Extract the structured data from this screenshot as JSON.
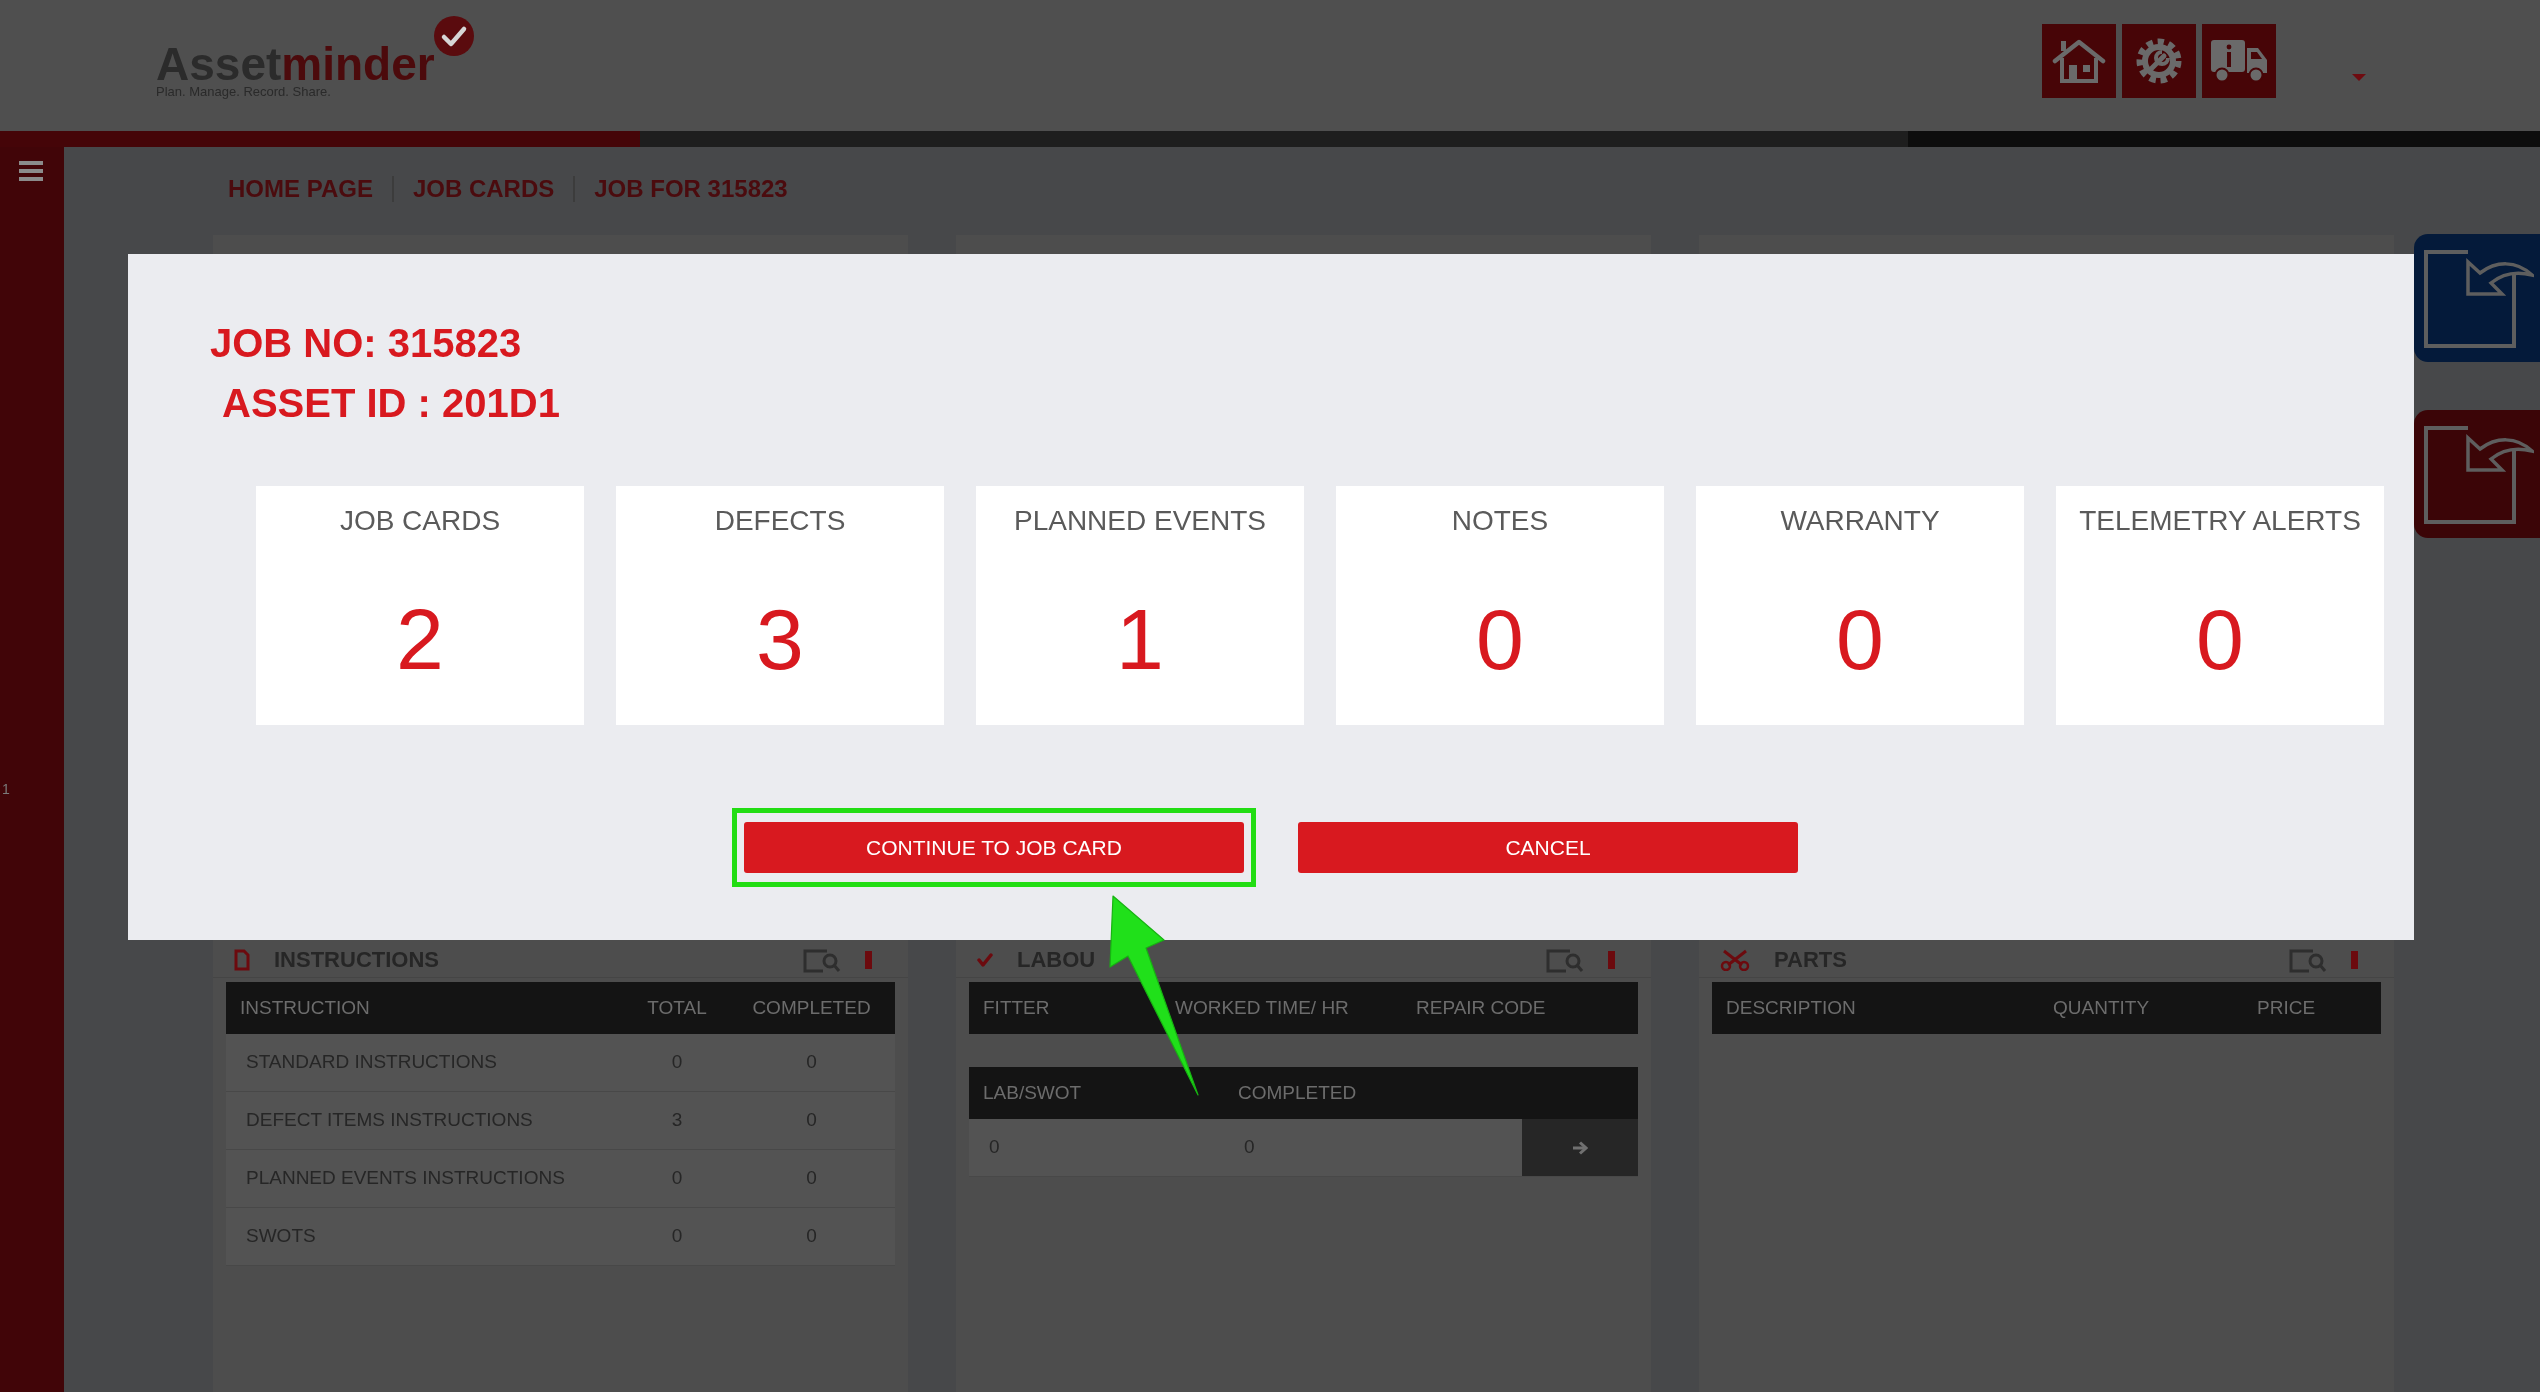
{
  "header": {
    "logo": {
      "wordmark": [
        "Asset",
        "minder"
      ],
      "tagline": "Plan. Manage. Record. Share."
    }
  },
  "sidebar": {
    "text": "1"
  },
  "breadcrumb": [
    {
      "label": "HOME PAGE"
    },
    {
      "label": "JOB CARDS"
    },
    {
      "label": "JOB FOR 315823"
    }
  ],
  "panels": [
    {
      "title": "INSTRUCTIONS",
      "tables": [
        {
          "columns": [
            "INSTRUCTION",
            "TOTAL",
            "COMPLETED"
          ],
          "rows": [
            [
              "STANDARD INSTRUCTIONS",
              "0",
              "0"
            ],
            [
              "DEFECT ITEMS INSTRUCTIONS",
              "3",
              "0"
            ],
            [
              "PLANNED EVENTS INSTRUCTIONS",
              "0",
              "0"
            ],
            [
              "SWOTS",
              "0",
              "0"
            ]
          ]
        }
      ]
    },
    {
      "title": "LABOU",
      "tables": [
        {
          "columns": [
            "FITTER",
            "WORKED TIME/ HR",
            "REPAIR CODE"
          ]
        },
        {
          "columns": [
            "LAB/SWOT",
            "COMPLETED"
          ],
          "rows": [
            [
              "0",
              "0"
            ]
          ],
          "row_button": true
        }
      ]
    },
    {
      "title": "PARTS",
      "tables": [
        {
          "columns": [
            "DESCRIPTION",
            "QUANTITY",
            "PRICE"
          ]
        }
      ]
    }
  ],
  "side_tabs": [
    {
      "color": "#041a3a"
    },
    {
      "color": "#3b0507"
    }
  ],
  "modal": {
    "job_no": "JOB NO: 315823",
    "asset_id": "ASSET ID : 201D1",
    "tiles": [
      {
        "label": "JOB CARDS",
        "count": "2"
      },
      {
        "label": "DEFECTS",
        "count": "3"
      },
      {
        "label": "PLANNED EVENTS",
        "count": "1"
      },
      {
        "label": "NOTES",
        "count": "0"
      },
      {
        "label": "WARRANTY",
        "count": "0"
      },
      {
        "label": "TELEMETRY ALERTS",
        "count": "0"
      }
    ],
    "buttons": [
      {
        "label": "CONTINUE TO JOB CARD",
        "highlighted": true
      },
      {
        "label": "CANCEL",
        "highlighted": false
      }
    ]
  }
}
